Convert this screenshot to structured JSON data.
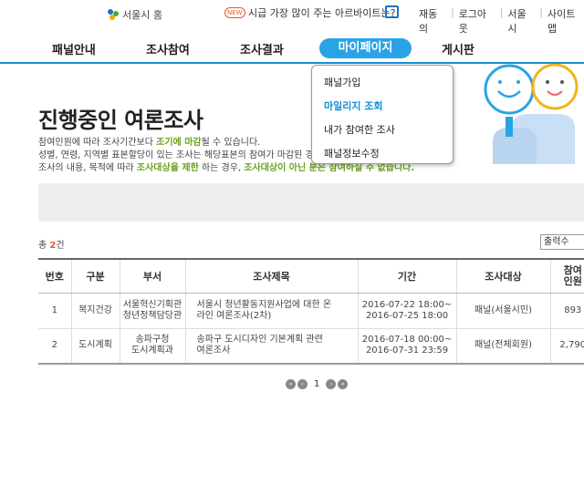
{
  "topbar": {
    "home_label": "서울시 홈",
    "new_badge": "NEW",
    "promo_text": "시급 가장 많이 주는 아르바이트는?",
    "links": [
      "재동의",
      "로그아웃",
      "서울시",
      "사이트맵"
    ]
  },
  "nav": {
    "items": [
      "패널안내",
      "조사참여",
      "조사결과",
      "마이페이지",
      "게시판"
    ]
  },
  "dropdown": {
    "items": [
      "패널가입",
      "마일리지 조회",
      "내가 참여한 조사",
      "패널정보수정"
    ]
  },
  "page": {
    "title": "진행중인 여론조사",
    "desc1_a": "참여인원에 따라 조사기간보다 ",
    "desc1_b": "조기에 마감",
    "desc1_c": "될 수 있습니다.",
    "desc2": "성별, 연령, 지역별 표본할당이 있는 조사는 해당표본의 참여가 마감된 경",
    "desc3_a": "조사의 내용, 목적에 따라 ",
    "desc3_b": "조사대상을 제한",
    "desc3_c": " 하는 경우, ",
    "desc3_d": "조사대상이 아닌 분은 참여하실 수 없습니다."
  },
  "list": {
    "total_prefix": "총 ",
    "total_count": "2",
    "total_suffix": "건",
    "sort_label": "출력수",
    "headers": [
      "번호",
      "구분",
      "부서",
      "조사제목",
      "기간",
      "조사대상",
      "참여인원"
    ],
    "rows": [
      {
        "no": "1",
        "category": "복지건강",
        "dept1": "서울혁신기획관",
        "dept2": "청년정책담당관",
        "title1": "서울시 청년활동지원사업에 대한 온",
        "title2": "라인 여론조사(2차)",
        "period1": "2016-07-22 18:00~",
        "period2": "2016-07-25 18:00",
        "target": "패널(서울시민)",
        "participants": "893"
      },
      {
        "no": "2",
        "category": "도시계획",
        "dept1": "송파구청",
        "dept2": "도시계획과",
        "title1": "송파구 도시디자인 기본계획 관련",
        "title2": "여론조사",
        "period1": "2016-07-18 00:00~",
        "period2": "2016-07-31 23:59",
        "target": "패널(전체회원)",
        "participants": "2,790"
      }
    ]
  },
  "pagination": {
    "current": "1"
  },
  "colors": {
    "accent": "#1790d0",
    "active_tab": "#2aa3e6",
    "highlight_green": "#6aa11d",
    "count_orange": "#e05a2a"
  }
}
